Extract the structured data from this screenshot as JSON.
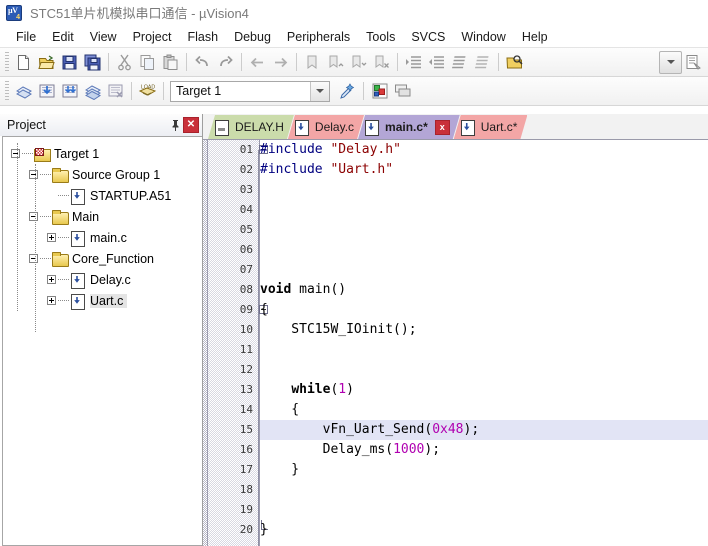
{
  "window": {
    "title": "STC51单片机模拟串口通信  - µVision4",
    "app_icon": "uvision-icon"
  },
  "menubar": {
    "items": [
      "File",
      "Edit",
      "View",
      "Project",
      "Flash",
      "Debug",
      "Peripherals",
      "Tools",
      "SVCS",
      "Window",
      "Help"
    ]
  },
  "toolbar_main": {
    "groups": [
      [
        "new-file-icon",
        "open-file-icon",
        "save-icon",
        "save-all-icon"
      ],
      [
        "cut-icon",
        "copy-icon",
        "paste-icon"
      ],
      [
        "undo-icon",
        "redo-icon"
      ],
      [
        "navigate-back-icon",
        "navigate-forward-icon"
      ],
      [
        "bookmark-toggle-icon",
        "bookmark-prev-icon",
        "bookmark-next-icon",
        "bookmark-clear-icon"
      ],
      [
        "indent-icon",
        "outdent-icon",
        "comment-icon",
        "uncomment-icon"
      ],
      [
        "find-in-files-icon"
      ]
    ],
    "right_icons": [
      "chevron-down-icon",
      "configure-icon"
    ]
  },
  "toolbar_build": {
    "icons": [
      "translate-icon",
      "build-icon",
      "rebuild-icon",
      "batch-build-icon",
      "stop-build-icon",
      "download-icon"
    ],
    "target_label": "Target 1",
    "right_icons": [
      "target-options-icon",
      "manage-components-icon",
      "multi-project-icon"
    ]
  },
  "project_panel": {
    "title": "Project",
    "pin_icon": "pin-icon",
    "close_icon": "close-icon",
    "tree": [
      {
        "label": "Target 1",
        "icon": "target-icon",
        "level": 0,
        "expander": "minus",
        "selected": false
      },
      {
        "label": "Source Group 1",
        "icon": "folder-icon",
        "level": 1,
        "expander": "minus",
        "selected": false
      },
      {
        "label": "STARTUP.A51",
        "icon": "file-icon",
        "level": 2,
        "expander": "none",
        "selected": false
      },
      {
        "label": "Main",
        "icon": "folder-icon",
        "level": 1,
        "expander": "minus",
        "selected": false
      },
      {
        "label": "main.c",
        "icon": "file-icon",
        "level": 2,
        "expander": "plus",
        "selected": false
      },
      {
        "label": "Core_Function",
        "icon": "folder-icon",
        "level": 1,
        "expander": "minus",
        "selected": false
      },
      {
        "label": "Delay.c",
        "icon": "file-icon",
        "level": 2,
        "expander": "plus",
        "selected": false
      },
      {
        "label": "Uart.c",
        "icon": "file-icon",
        "level": 2,
        "expander": "plus",
        "selected": true
      }
    ]
  },
  "editor": {
    "tabs": [
      {
        "label": "DELAY.H",
        "color": "green",
        "active": false,
        "closable": false,
        "kind": "header"
      },
      {
        "label": "Delay.c",
        "color": "pink",
        "active": false,
        "closable": false,
        "kind": "source"
      },
      {
        "label": "main.c*",
        "color": "purple",
        "active": true,
        "closable": true,
        "kind": "source"
      },
      {
        "label": "Uart.c*",
        "color": "pink2",
        "active": false,
        "closable": false,
        "kind": "source"
      }
    ],
    "close_tab_label": "x",
    "highlighted_line": 15,
    "lines": [
      {
        "n": "01",
        "fold": "start",
        "tokens": [
          {
            "t": "#include ",
            "c": "pre"
          },
          {
            "t": "\"Delay.h\"",
            "c": "str"
          }
        ]
      },
      {
        "n": "02",
        "fold": "none",
        "tokens": [
          {
            "t": "#include ",
            "c": "pre"
          },
          {
            "t": "\"Uart.h\"",
            "c": "str"
          }
        ]
      },
      {
        "n": "03",
        "fold": "none",
        "tokens": []
      },
      {
        "n": "04",
        "fold": "none",
        "tokens": []
      },
      {
        "n": "05",
        "fold": "none",
        "tokens": []
      },
      {
        "n": "06",
        "fold": "none",
        "tokens": []
      },
      {
        "n": "07",
        "fold": "none",
        "tokens": []
      },
      {
        "n": "08",
        "fold": "none",
        "tokens": [
          {
            "t": "void ",
            "c": "kw"
          },
          {
            "t": "main()",
            "c": "pln"
          }
        ]
      },
      {
        "n": "09",
        "fold": "start",
        "tokens": [
          {
            "t": "{",
            "c": "punc"
          }
        ]
      },
      {
        "n": "10",
        "fold": "none",
        "tokens": [
          {
            "t": "    STC15W_IOinit();",
            "c": "pln"
          }
        ]
      },
      {
        "n": "11",
        "fold": "none",
        "tokens": []
      },
      {
        "n": "12",
        "fold": "none",
        "tokens": []
      },
      {
        "n": "13",
        "fold": "none",
        "tokens": [
          {
            "t": "    ",
            "c": "pln"
          },
          {
            "t": "while",
            "c": "kw"
          },
          {
            "t": "(",
            "c": "punc"
          },
          {
            "t": "1",
            "c": "num"
          },
          {
            "t": ")",
            "c": "punc"
          }
        ]
      },
      {
        "n": "14",
        "fold": "none",
        "tokens": [
          {
            "t": "    {",
            "c": "punc"
          }
        ]
      },
      {
        "n": "15",
        "fold": "none",
        "tokens": [
          {
            "t": "        vFn_Uart_Send(",
            "c": "pln"
          },
          {
            "t": "0x48",
            "c": "num"
          },
          {
            "t": ");",
            "c": "pln"
          }
        ]
      },
      {
        "n": "16",
        "fold": "none",
        "tokens": [
          {
            "t": "        Delay_ms(",
            "c": "pln"
          },
          {
            "t": "1000",
            "c": "num"
          },
          {
            "t": ");",
            "c": "pln"
          }
        ]
      },
      {
        "n": "17",
        "fold": "none",
        "tokens": [
          {
            "t": "    }",
            "c": "punc"
          }
        ]
      },
      {
        "n": "18",
        "fold": "none",
        "tokens": []
      },
      {
        "n": "19",
        "fold": "none",
        "tokens": []
      },
      {
        "n": "20",
        "fold": "end",
        "tokens": [
          {
            "t": "}",
            "c": "punc"
          }
        ]
      }
    ]
  },
  "colors": {
    "tab_active": "#b3a6d6",
    "tab_header": "#cbdcab",
    "tab_source": "#f3a6a6",
    "close_red": "#c9303a",
    "preprocessor": "#000080",
    "string": "#8b0000",
    "number": "#b000b0",
    "current_line": "#e2e4f5"
  }
}
